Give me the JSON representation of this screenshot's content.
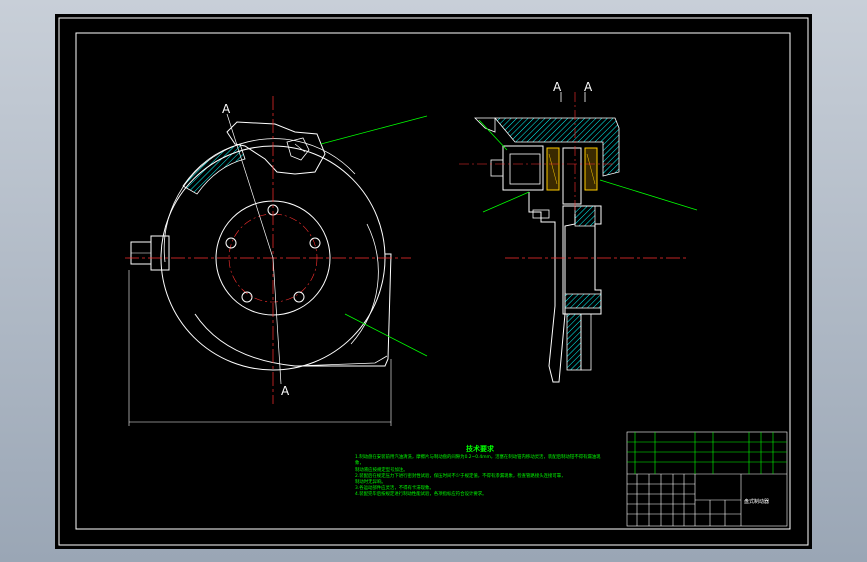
{
  "drawing": {
    "section_labels": {
      "left_top": "A",
      "left_bottom": "A",
      "right_left": "A",
      "right_right": "A"
    },
    "tech_requirements": {
      "title": "技术要求",
      "lines": [
        "1.制动盘在安装前用汽油清洗，摩擦片与制动盘的间隙为0.2~0.4mm，活塞在制动钳内移动灵活，装配后制动钳不得有漏油现象，",
        "   制动液应按规定型号加注。",
        "2.装配后在规定压力下进行密封性试验，保压时间不少于规定值，不得有渗漏现象，检查管路接头连接可靠，",
        "   制动时无异响。",
        "3.各运动部件应灵活，不得有卡滞现象。",
        "4.装配完毕后按规定进行制动性能试验，各项指标应符合设计要求。"
      ]
    },
    "title_block": {
      "part_name": "盘式制动器"
    }
  }
}
